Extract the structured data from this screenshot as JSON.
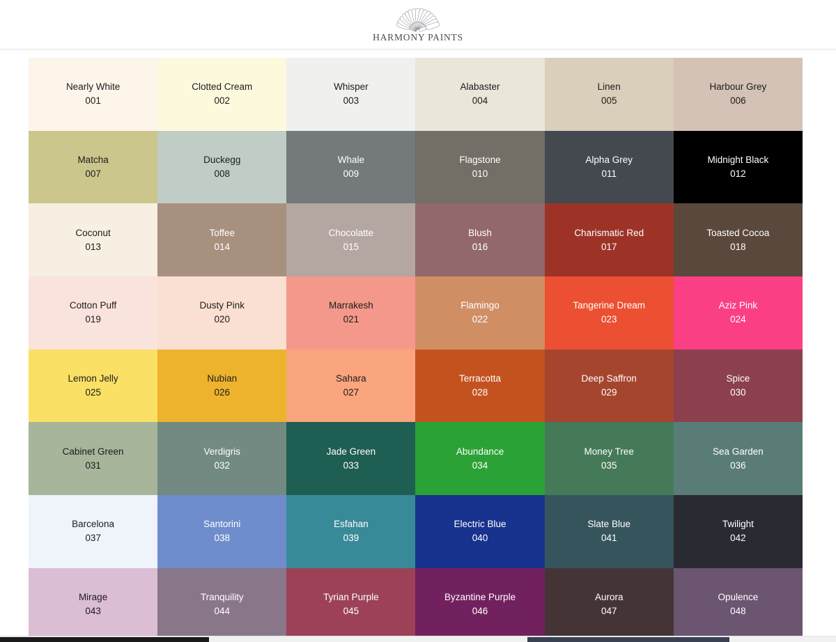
{
  "header": {
    "brand_name": "HARMONY PAINTS",
    "logo_icon": "paint-fan-logo",
    "logo_description": "fan of paint brushes arch"
  },
  "palette": {
    "columns": 6,
    "rows": 8,
    "total": 48,
    "swatches": [
      {
        "name": "Nearly White",
        "code": "001",
        "hex": "#fdf4ea",
        "text": "dark"
      },
      {
        "name": "Clotted Cream",
        "code": "002",
        "hex": "#fcf9dd",
        "text": "dark"
      },
      {
        "name": "Whisper",
        "code": "003",
        "hex": "#f0f0ef",
        "text": "dark"
      },
      {
        "name": "Alabaster",
        "code": "004",
        "hex": "#eae6da",
        "text": "dark"
      },
      {
        "name": "Linen",
        "code": "005",
        "hex": "#d9cfba",
        "text": "dark"
      },
      {
        "name": "Harbour Grey",
        "code": "006",
        "hex": "#d3c2b5",
        "text": "dark"
      },
      {
        "name": "Matcha",
        "code": "007",
        "hex": "#cbc68c",
        "text": "dark"
      },
      {
        "name": "Duckegg",
        "code": "008",
        "hex": "#c0cdc6",
        "text": "dark"
      },
      {
        "name": "Whale",
        "code": "009",
        "hex": "#74797c",
        "text": "light"
      },
      {
        "name": "Flagstone",
        "code": "010",
        "hex": "#736e66",
        "text": "light"
      },
      {
        "name": "Alpha Grey",
        "code": "011",
        "hex": "#444950",
        "text": "light"
      },
      {
        "name": "Midnight Black",
        "code": "012",
        "hex": "#000000",
        "text": "light"
      },
      {
        "name": "Coconut",
        "code": "013",
        "hex": "#f6efe2",
        "text": "dark"
      },
      {
        "name": "Toffee",
        "code": "014",
        "hex": "#a8907f",
        "text": "light"
      },
      {
        "name": "Chocolatte",
        "code": "015",
        "hex": "#b4a6a1",
        "text": "light"
      },
      {
        "name": "Blush",
        "code": "016",
        "hex": "#93686b",
        "text": "light"
      },
      {
        "name": "Charismatic Red",
        "code": "017",
        "hex": "#9d3327",
        "text": "light"
      },
      {
        "name": "Toasted Cocoa",
        "code": "018",
        "hex": "#5b483c",
        "text": "light"
      },
      {
        "name": "Cotton Puff",
        "code": "019",
        "hex": "#fae3dc",
        "text": "dark"
      },
      {
        "name": "Dusty Pink",
        "code": "020",
        "hex": "#fae0d2",
        "text": "dark"
      },
      {
        "name": "Marrakesh",
        "code": "021",
        "hex": "#f4988b",
        "text": "dark"
      },
      {
        "name": "Flamingo",
        "code": "022",
        "hex": "#d08e65",
        "text": "light"
      },
      {
        "name": "Tangerine Dream",
        "code": "023",
        "hex": "#ec4f31",
        "text": "light"
      },
      {
        "name": "Aziz Pink",
        "code": "024",
        "hex": "#fb3f85",
        "text": "light"
      },
      {
        "name": "Lemon Jelly",
        "code": "025",
        "hex": "#fae064",
        "text": "dark"
      },
      {
        "name": "Nubian",
        "code": "026",
        "hex": "#edb32c",
        "text": "dark"
      },
      {
        "name": "Sahara",
        "code": "027",
        "hex": "#faa57e",
        "text": "dark"
      },
      {
        "name": "Terracotta",
        "code": "028",
        "hex": "#c4521f",
        "text": "light"
      },
      {
        "name": "Deep Saffron",
        "code": "029",
        "hex": "#a6452e",
        "text": "light"
      },
      {
        "name": "Spice",
        "code": "030",
        "hex": "#8c404d",
        "text": "light"
      },
      {
        "name": "Cabinet Green",
        "code": "031",
        "hex": "#a7b59b",
        "text": "dark"
      },
      {
        "name": "Verdigris",
        "code": "032",
        "hex": "#728a81",
        "text": "light"
      },
      {
        "name": "Jade Green",
        "code": "033",
        "hex": "#1f5e52",
        "text": "light"
      },
      {
        "name": "Abundance",
        "code": "034",
        "hex": "#2ba235",
        "text": "light"
      },
      {
        "name": "Money Tree",
        "code": "035",
        "hex": "#447a58",
        "text": "light"
      },
      {
        "name": "Sea Garden",
        "code": "036",
        "hex": "#5a7c77",
        "text": "light"
      },
      {
        "name": "Barcelona",
        "code": "037",
        "hex": "#eef4fa",
        "text": "dark"
      },
      {
        "name": "Santorini",
        "code": "038",
        "hex": "#6f8dcc",
        "text": "light"
      },
      {
        "name": "Esfahan",
        "code": "039",
        "hex": "#398a99",
        "text": "light"
      },
      {
        "name": "Electric Blue",
        "code": "040",
        "hex": "#17338d",
        "text": "light"
      },
      {
        "name": "Slate Blue",
        "code": "041",
        "hex": "#36545c",
        "text": "light"
      },
      {
        "name": "Twilight",
        "code": "042",
        "hex": "#2a2a33",
        "text": "light"
      },
      {
        "name": "Mirage",
        "code": "043",
        "hex": "#dbbdd4",
        "text": "dark"
      },
      {
        "name": "Tranquility",
        "code": "044",
        "hex": "#8a7689",
        "text": "light"
      },
      {
        "name": "Tyrian Purple",
        "code": "045",
        "hex": "#9c4158",
        "text": "light"
      },
      {
        "name": "Byzantine Purple",
        "code": "046",
        "hex": "#72215f",
        "text": "light"
      },
      {
        "name": "Aurora",
        "code": "047",
        "hex": "#453436",
        "text": "light"
      },
      {
        "name": "Opulence",
        "code": "048",
        "hex": "#6c5570",
        "text": "light"
      }
    ]
  },
  "scrollbar": {
    "orientation": "horizontal",
    "position_percent": 0
  }
}
